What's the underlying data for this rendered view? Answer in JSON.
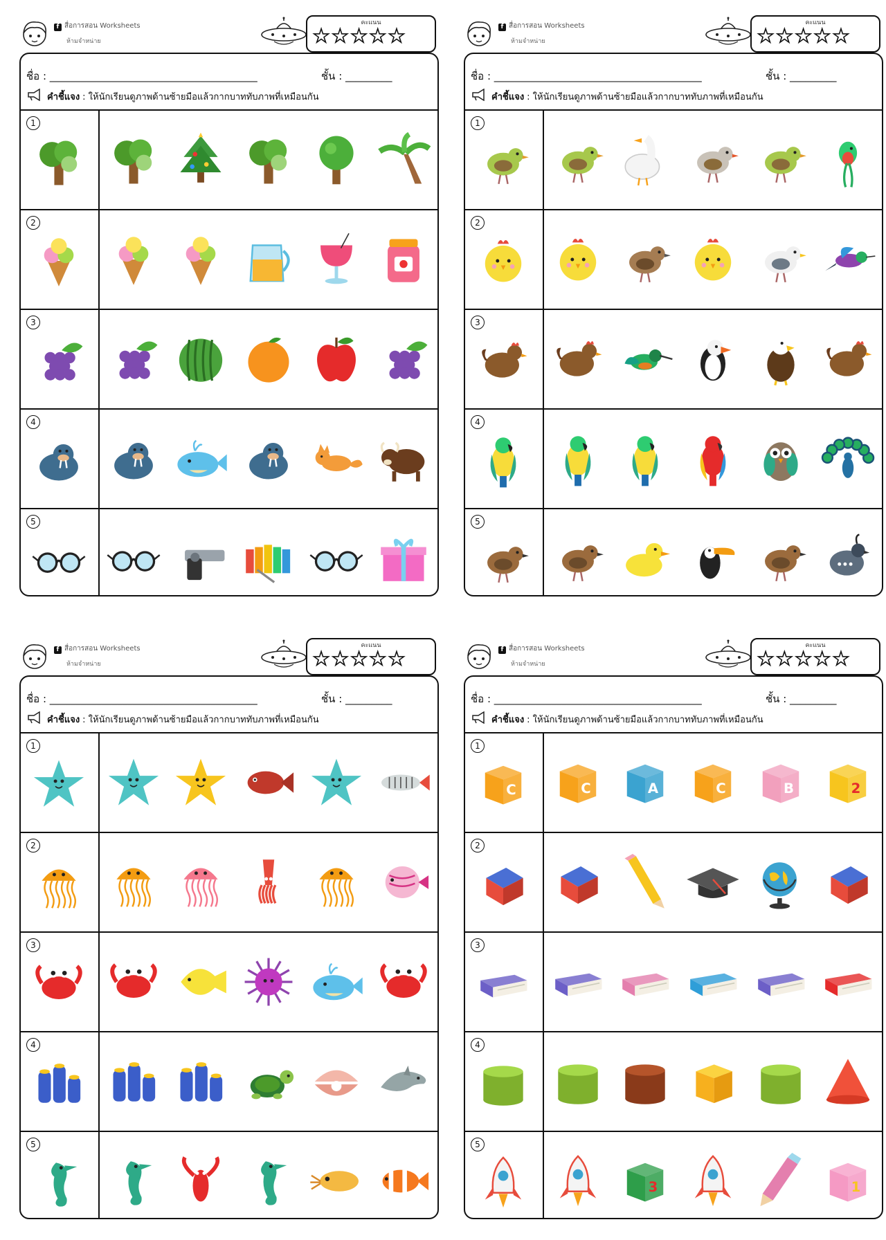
{
  "header": {
    "brand": "สื่อการสอน Worksheets",
    "brand_sub": "ห้ามจำหน่าย",
    "fb": "f",
    "score_label": "คะแนน",
    "star_count": 5
  },
  "form": {
    "name_label": "ชื่อ : ________________________________________",
    "class_label": "ชั้น : _________",
    "instruction_label": "คำชี้แจง",
    "instruction_text": ": ให้นักเรียนดูภาพด้านซ้ายมือแล้วกากบาททับภาพที่เหมือนกัน"
  },
  "sheets": [
    {
      "rows": [
        {
          "num": "1",
          "items": [
            "tree",
            "christmas-tree",
            "tree",
            "round-tree",
            "palm-tree"
          ]
        },
        {
          "num": "2",
          "items": [
            "ice-cream",
            "ice-cream",
            "juice-jug",
            "pink-drink",
            "jam-jar"
          ]
        },
        {
          "num": "3",
          "items": [
            "grapes",
            "watermelon",
            "orange",
            "apple",
            "grapes"
          ]
        },
        {
          "num": "4",
          "items": [
            "walrus",
            "whale",
            "walrus",
            "fox",
            "buffalo"
          ]
        },
        {
          "num": "5",
          "items": [
            "glasses",
            "toy-gun",
            "xylophone",
            "glasses",
            "gift-box"
          ]
        }
      ]
    },
    {
      "rows": [
        {
          "num": "1",
          "items": [
            "green-bird",
            "goose",
            "finch",
            "green-bird",
            "quetzal"
          ]
        },
        {
          "num": "2",
          "items": [
            "chick",
            "sparrow",
            "chick",
            "gull",
            "hummingbird"
          ]
        },
        {
          "num": "3",
          "items": [
            "hen",
            "kingfisher",
            "puffin",
            "eagle",
            "hen"
          ]
        },
        {
          "num": "4",
          "items": [
            "parrot",
            "parrot",
            "macaw",
            "owl",
            "peacock"
          ]
        },
        {
          "num": "5",
          "items": [
            "robin",
            "duck",
            "toucan",
            "robin",
            "quail"
          ]
        }
      ]
    },
    {
      "rows": [
        {
          "num": "1",
          "items": [
            "blue-starfish",
            "yellow-starfish",
            "piranha",
            "blue-starfish",
            "xray-fish"
          ]
        },
        {
          "num": "2",
          "items": [
            "orange-jellyfish",
            "pink-jellyfish",
            "squid",
            "orange-jellyfish",
            "discus-fish"
          ]
        },
        {
          "num": "3",
          "items": [
            "crab",
            "yellow-tang",
            "sea-urchin",
            "whale",
            "crab"
          ]
        },
        {
          "num": "4",
          "items": [
            "sponge",
            "sponge",
            "turtle",
            "clam",
            "dolphin"
          ]
        },
        {
          "num": "5",
          "items": [
            "seahorse",
            "lobster",
            "seahorse",
            "cuttlefish",
            "clownfish"
          ]
        }
      ]
    },
    {
      "rows": [
        {
          "num": "1",
          "items": [
            "block-c",
            "block-a",
            "block-c",
            "block-b",
            "block-2"
          ]
        },
        {
          "num": "2",
          "items": [
            "eraser",
            "pencil",
            "grad-cap",
            "globe",
            "eraser"
          ]
        },
        {
          "num": "3",
          "items": [
            "purple-book",
            "pink-book",
            "blue-book",
            "purple-book",
            "red-book"
          ]
        },
        {
          "num": "4",
          "items": [
            "green-cylinder",
            "brown-cylinder",
            "yellow-cube",
            "green-cylinder",
            "red-cone"
          ]
        },
        {
          "num": "5",
          "items": [
            "rocket",
            "block-3",
            "rocket",
            "pink-pencil",
            "block-1"
          ]
        }
      ]
    }
  ]
}
